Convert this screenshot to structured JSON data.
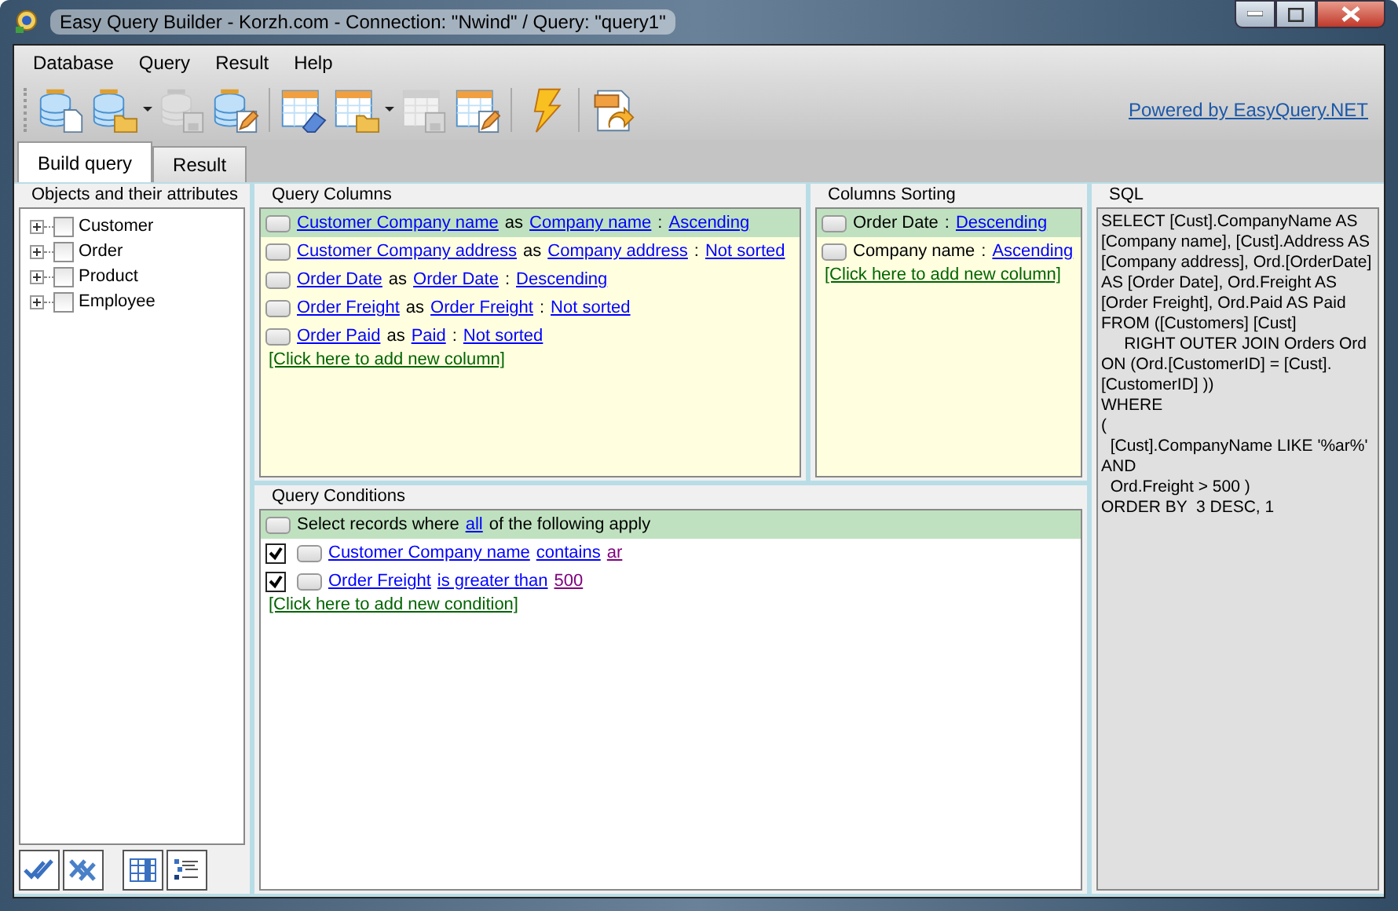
{
  "window": {
    "title": "Easy Query Builder - Korzh.com - Connection: \"Nwind\" / Query: \"query1\""
  },
  "menu": [
    "Database",
    "Query",
    "Result",
    "Help"
  ],
  "toolbar": [
    {
      "kind": "db-new",
      "disabled": false,
      "dropdown": false
    },
    {
      "kind": "db-open",
      "disabled": false,
      "dropdown": true
    },
    {
      "kind": "db-save",
      "disabled": true,
      "dropdown": false
    },
    {
      "kind": "db-edit",
      "disabled": false,
      "dropdown": false
    },
    {
      "kind": "separator"
    },
    {
      "kind": "query-clear",
      "disabled": false,
      "dropdown": false
    },
    {
      "kind": "query-open",
      "disabled": false,
      "dropdown": true
    },
    {
      "kind": "query-save",
      "disabled": true,
      "dropdown": false
    },
    {
      "kind": "query-edit",
      "disabled": false,
      "dropdown": false
    },
    {
      "kind": "separator"
    },
    {
      "kind": "execute",
      "disabled": false,
      "dropdown": false
    },
    {
      "kind": "separator"
    },
    {
      "kind": "export-csv",
      "disabled": false,
      "dropdown": false
    }
  ],
  "powered_link": "Powered by EasyQuery.NET",
  "tabs": [
    {
      "label": "Build query",
      "selected": true
    },
    {
      "label": "Result",
      "selected": false
    }
  ],
  "objects_panel": {
    "title": "Objects and their attributes",
    "items": [
      {
        "label": "Customer",
        "checked": false,
        "expanded": false
      },
      {
        "label": "Order",
        "checked": false,
        "expanded": false
      },
      {
        "label": "Product",
        "checked": false,
        "expanded": false
      },
      {
        "label": "Employee",
        "checked": false,
        "expanded": false
      }
    ]
  },
  "columns_panel": {
    "title": "Query Columns",
    "rows": [
      {
        "field": "Customer Company name",
        "as": "as",
        "alias": "Company name",
        "colon": ":",
        "sorting": "Ascending",
        "selected": true
      },
      {
        "field": "Customer Company address",
        "as": "as",
        "alias": "Company address",
        "colon": ":",
        "sorting": "Not sorted",
        "selected": false
      },
      {
        "field": "Order Date",
        "as": "as",
        "alias": "Order Date",
        "colon": ":",
        "sorting": "Descending",
        "selected": false
      },
      {
        "field": "Order Freight",
        "as": "as",
        "alias": "Order Freight",
        "colon": ":",
        "sorting": "Not sorted",
        "selected": false
      },
      {
        "field": "Order Paid",
        "as": "as",
        "alias": "Paid",
        "colon": ":",
        "sorting": "Not sorted",
        "selected": false
      }
    ],
    "add_link": "[Click here to add new column]"
  },
  "sorting_panel": {
    "title": "Columns Sorting",
    "rows": [
      {
        "field": "Order Date",
        "colon": ":",
        "order": "Descending",
        "selected": true
      },
      {
        "field": "Company name",
        "colon": ":",
        "order": "Ascending",
        "selected": false
      }
    ],
    "add_link": "[Click here to add new column]"
  },
  "sql_panel": {
    "title": "SQL",
    "lines": [
      "SELECT [Cust].CompanyName AS",
      "[Company name], [Cust].Address AS",
      "[Company address], Ord.[OrderDate]",
      "AS [Order Date], Ord.Freight AS",
      "[Order Freight], Ord.Paid AS Paid",
      "FROM ([Customers] [Cust]",
      "     RIGHT OUTER JOIN Orders Ord",
      "ON (Ord.[CustomerID] = [Cust].",
      "[CustomerID] ))",
      "WHERE",
      "(",
      "  [Cust].CompanyName LIKE '%ar%'",
      "AND",
      "  Ord.Freight > 500 )",
      "ORDER BY  3 DESC, 1"
    ]
  },
  "conditions_panel": {
    "title": "Query Conditions",
    "header": {
      "prefix": "Select records where",
      "link": "all",
      "suffix": "of the following apply"
    },
    "rows": [
      {
        "enabled": true,
        "field": "Customer Company name",
        "operator": "contains",
        "value": "ar"
      },
      {
        "enabled": true,
        "field": "Order Freight",
        "operator": "is greater than",
        "value": "500"
      }
    ],
    "add_link": "[Click here to add new condition]"
  }
}
